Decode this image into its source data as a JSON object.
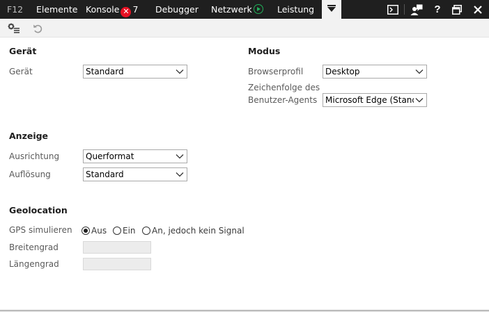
{
  "tabs": {
    "f12": "F12",
    "elements": "Elemente",
    "console": "Konsole",
    "console_error_count": "7",
    "debugger": "Debugger",
    "network": "Netzwerk",
    "performance": "Leistung"
  },
  "device": {
    "section_title": "Gerät",
    "device_label": "Gerät",
    "device_value": "Standard"
  },
  "mode": {
    "section_title": "Modus",
    "browser_profile_label": "Browserprofil",
    "browser_profile_value": "Desktop",
    "user_agent_label_line1": "Zeichenfolge des",
    "user_agent_label_line2": "Benutzer-Agents",
    "user_agent_value": "Microsoft Edge (Standard)"
  },
  "display": {
    "section_title": "Anzeige",
    "orientation_label": "Ausrichtung",
    "orientation_value": "Querformat",
    "resolution_label": "Auflösung",
    "resolution_value": "Standard"
  },
  "geolocation": {
    "section_title": "Geolocation",
    "gps_label": "GPS simulieren",
    "options": [
      "Aus",
      "Ein",
      "An, jedoch kein Signal"
    ],
    "selected": "Aus",
    "latitude_label": "Breitengrad",
    "longitude_label": "Längengrad"
  }
}
